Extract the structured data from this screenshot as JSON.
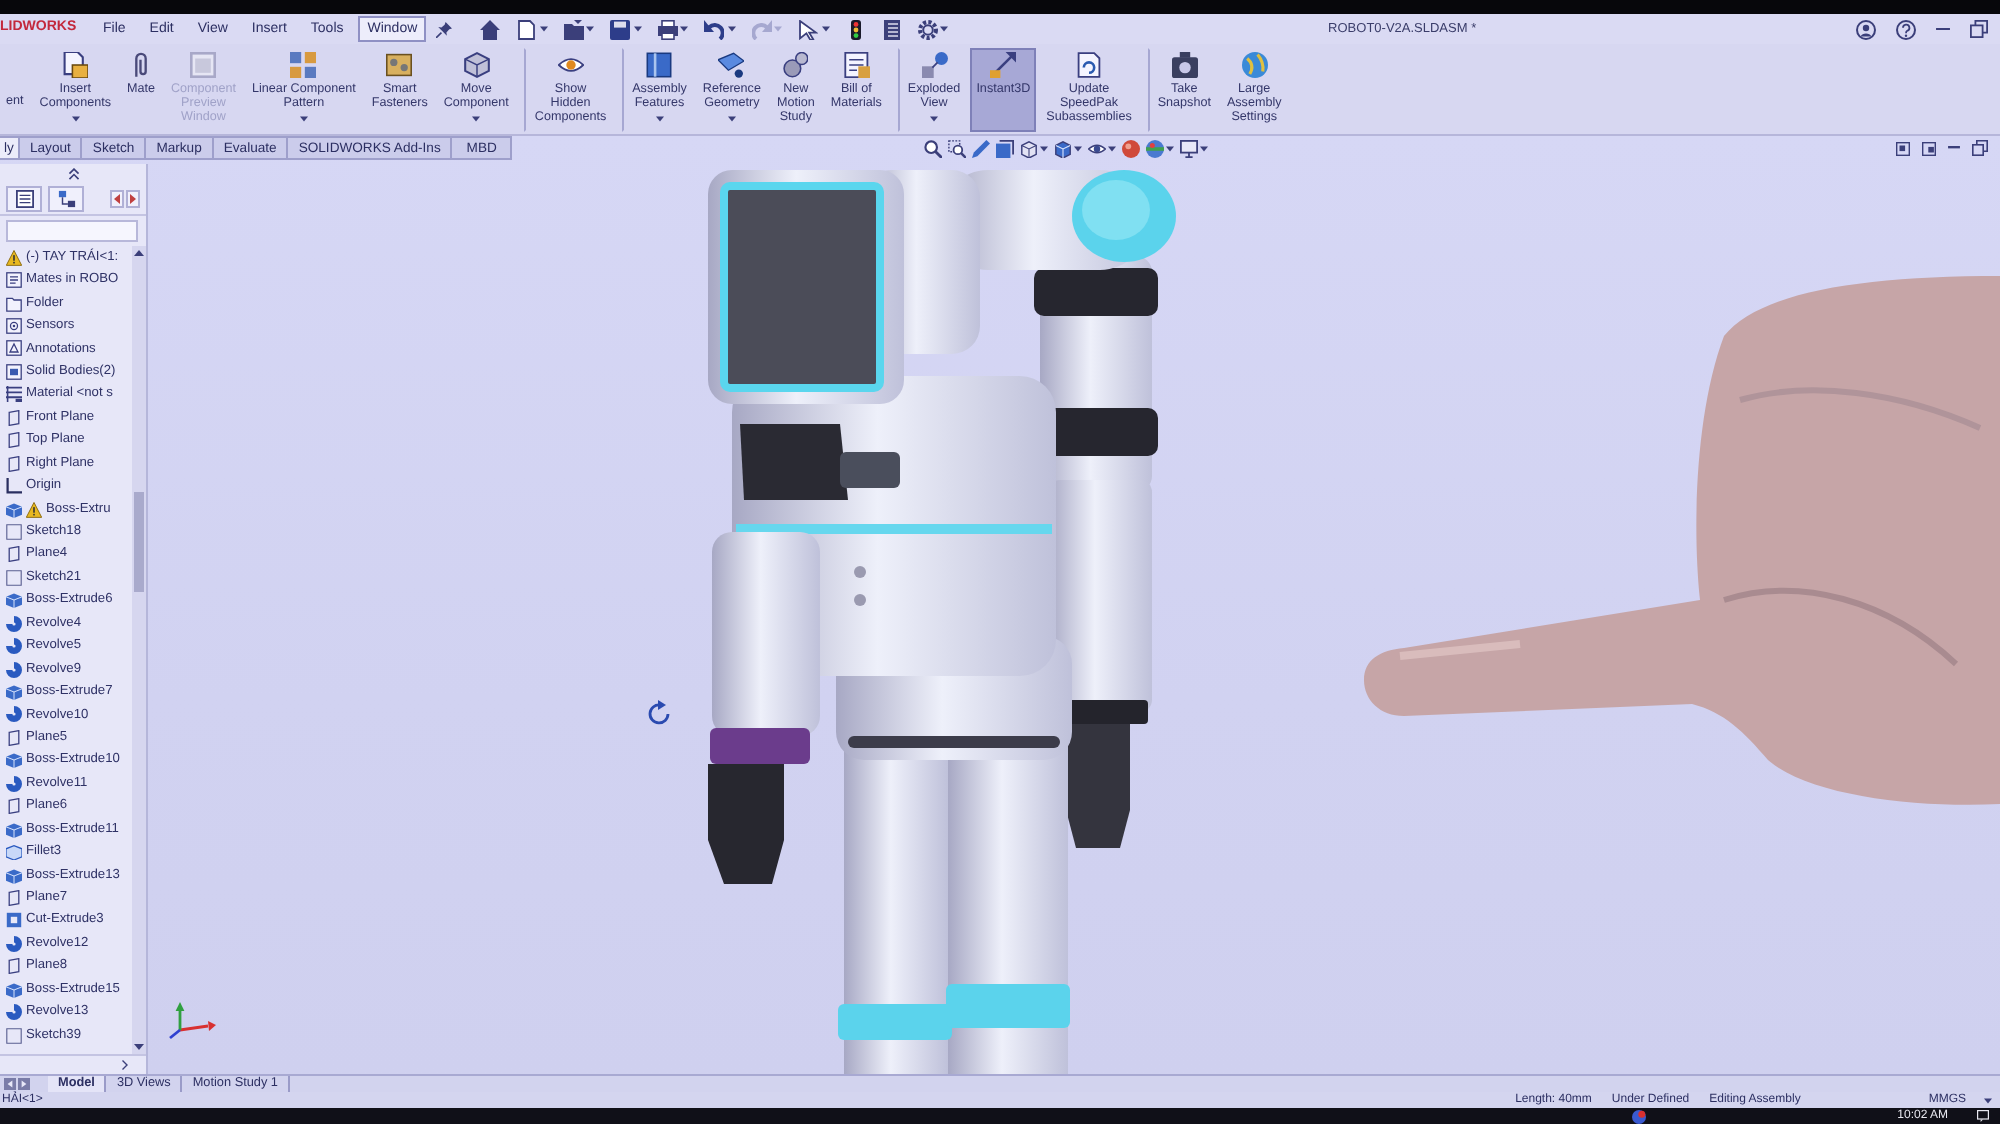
{
  "title_bar": {
    "logo": "LIDWORKS",
    "menus": [
      {
        "label": "File",
        "selected": false
      },
      {
        "label": "Edit",
        "selected": false
      },
      {
        "label": "View",
        "selected": false
      },
      {
        "label": "Insert",
        "selected": false
      },
      {
        "label": "Tools",
        "selected": false
      },
      {
        "label": "Window",
        "selected": true
      }
    ],
    "document_title": "ROBOT0-V2A.SLDASM *"
  },
  "command_manager": {
    "buttons": [
      {
        "label": "ent",
        "disabled": false,
        "dropdown": false,
        "selected": false,
        "divider_before": false
      },
      {
        "label": "Insert\nComponents",
        "disabled": false,
        "dropdown": true,
        "selected": false,
        "divider_before": false
      },
      {
        "label": "Mate",
        "disabled": false,
        "dropdown": false,
        "selected": false,
        "divider_before": false
      },
      {
        "label": "Component\nPreview\nWindow",
        "disabled": true,
        "dropdown": false,
        "selected": false,
        "divider_before": false
      },
      {
        "label": "Linear Component\nPattern",
        "disabled": false,
        "dropdown": true,
        "selected": false,
        "divider_before": false
      },
      {
        "label": "Smart\nFasteners",
        "disabled": false,
        "dropdown": false,
        "selected": false,
        "divider_before": false
      },
      {
        "label": "Move\nComponent",
        "disabled": false,
        "dropdown": true,
        "selected": false,
        "divider_before": false
      },
      {
        "label": "Show\nHidden\nComponents",
        "disabled": false,
        "dropdown": false,
        "selected": false,
        "divider_before": true
      },
      {
        "label": "Assembly\nFeatures",
        "disabled": false,
        "dropdown": true,
        "selected": false,
        "divider_before": true
      },
      {
        "label": "Reference\nGeometry",
        "disabled": false,
        "dropdown": true,
        "selected": false,
        "divider_before": false
      },
      {
        "label": "New\nMotion\nStudy",
        "disabled": false,
        "dropdown": false,
        "selected": false,
        "divider_before": false
      },
      {
        "label": "Bill of\nMaterials",
        "disabled": false,
        "dropdown": false,
        "selected": false,
        "divider_before": false
      },
      {
        "label": "Exploded\nView",
        "disabled": false,
        "dropdown": true,
        "selected": false,
        "divider_before": true
      },
      {
        "label": "Instant3D",
        "disabled": false,
        "dropdown": false,
        "selected": true,
        "divider_before": false
      },
      {
        "label": "Update\nSpeedPak\nSubassemblies",
        "disabled": false,
        "dropdown": false,
        "selected": false,
        "divider_before": false
      },
      {
        "label": "Take\nSnapshot",
        "disabled": false,
        "dropdown": false,
        "selected": false,
        "divider_before": true
      },
      {
        "label": "Large\nAssembly\nSettings",
        "disabled": false,
        "dropdown": false,
        "selected": false,
        "divider_before": false
      }
    ],
    "tabs": [
      {
        "label": "ly",
        "selected": true
      },
      {
        "label": "Layout",
        "selected": false
      },
      {
        "label": "Sketch",
        "selected": false
      },
      {
        "label": "Markup",
        "selected": false
      },
      {
        "label": "Evaluate",
        "selected": false
      },
      {
        "label": "SOLIDWORKS Add-Ins",
        "selected": false
      },
      {
        "label": "MBD",
        "selected": false
      }
    ]
  },
  "feature_tree": {
    "items": [
      {
        "label": "(-) TAY TRÁI<1:",
        "kind": "component",
        "warning": true
      },
      {
        "label": "Mates in ROBO",
        "kind": "mates",
        "warning": false
      },
      {
        "label": "Folder",
        "kind": "folder",
        "warning": false
      },
      {
        "label": "Sensors",
        "kind": "sensors",
        "warning": false
      },
      {
        "label": "Annotations",
        "kind": "annotations",
        "warning": false
      },
      {
        "label": "Solid Bodies(2)",
        "kind": "solid_bodies",
        "warning": false
      },
      {
        "label": "Material <not s",
        "kind": "material",
        "warning": false
      },
      {
        "label": "Front Plane",
        "kind": "plane",
        "warning": false
      },
      {
        "label": "Top Plane",
        "kind": "plane",
        "warning": false
      },
      {
        "label": "Right Plane",
        "kind": "plane",
        "warning": false
      },
      {
        "label": "Origin",
        "kind": "origin",
        "warning": false
      },
      {
        "label": "Boss-Extru",
        "kind": "boss_extrude",
        "warning": true
      },
      {
        "label": "Sketch18",
        "kind": "sketch",
        "warning": false
      },
      {
        "label": "Plane4",
        "kind": "plane",
        "warning": false
      },
      {
        "label": "Sketch21",
        "kind": "sketch",
        "warning": false
      },
      {
        "label": "Boss-Extrude6",
        "kind": "boss_extrude",
        "warning": false
      },
      {
        "label": "Revolve4",
        "kind": "revolve",
        "warning": false
      },
      {
        "label": "Revolve5",
        "kind": "revolve",
        "warning": false
      },
      {
        "label": "Revolve9",
        "kind": "revolve",
        "warning": false
      },
      {
        "label": "Boss-Extrude7",
        "kind": "boss_extrude",
        "warning": false
      },
      {
        "label": "Revolve10",
        "kind": "revolve",
        "warning": false
      },
      {
        "label": "Plane5",
        "kind": "plane",
        "warning": false
      },
      {
        "label": "Boss-Extrude10",
        "kind": "boss_extrude",
        "warning": false
      },
      {
        "label": "Revolve11",
        "kind": "revolve",
        "warning": false
      },
      {
        "label": "Plane6",
        "kind": "plane",
        "warning": false
      },
      {
        "label": "Boss-Extrude11",
        "kind": "boss_extrude",
        "warning": false
      },
      {
        "label": "Fillet3",
        "kind": "fillet",
        "warning": false
      },
      {
        "label": "Boss-Extrude13",
        "kind": "boss_extrude",
        "warning": false
      },
      {
        "label": "Plane7",
        "kind": "plane",
        "warning": false
      },
      {
        "label": "Cut-Extrude3",
        "kind": "cut_extrude",
        "warning": false
      },
      {
        "label": "Revolve12",
        "kind": "revolve",
        "warning": false
      },
      {
        "label": "Plane8",
        "kind": "plane",
        "warning": false
      },
      {
        "label": "Boss-Extrude15",
        "kind": "boss_extrude",
        "warning": false
      },
      {
        "label": "Revolve13",
        "kind": "revolve",
        "warning": false
      },
      {
        "label": "Sketch39",
        "kind": "sketch",
        "warning": false
      }
    ]
  },
  "bottom_tabs": [
    {
      "label": "Model",
      "selected": true
    },
    {
      "label": "3D Views",
      "selected": false
    },
    {
      "label": "Motion Study 1",
      "selected": false
    }
  ],
  "status_bar": {
    "component": "HẢI<1>",
    "length": "Length: 40mm",
    "sketch_state": "Under Defined",
    "mode": "Editing Assembly",
    "units": "MMGS"
  },
  "taskbar": {
    "clock": "10:02 AM"
  }
}
